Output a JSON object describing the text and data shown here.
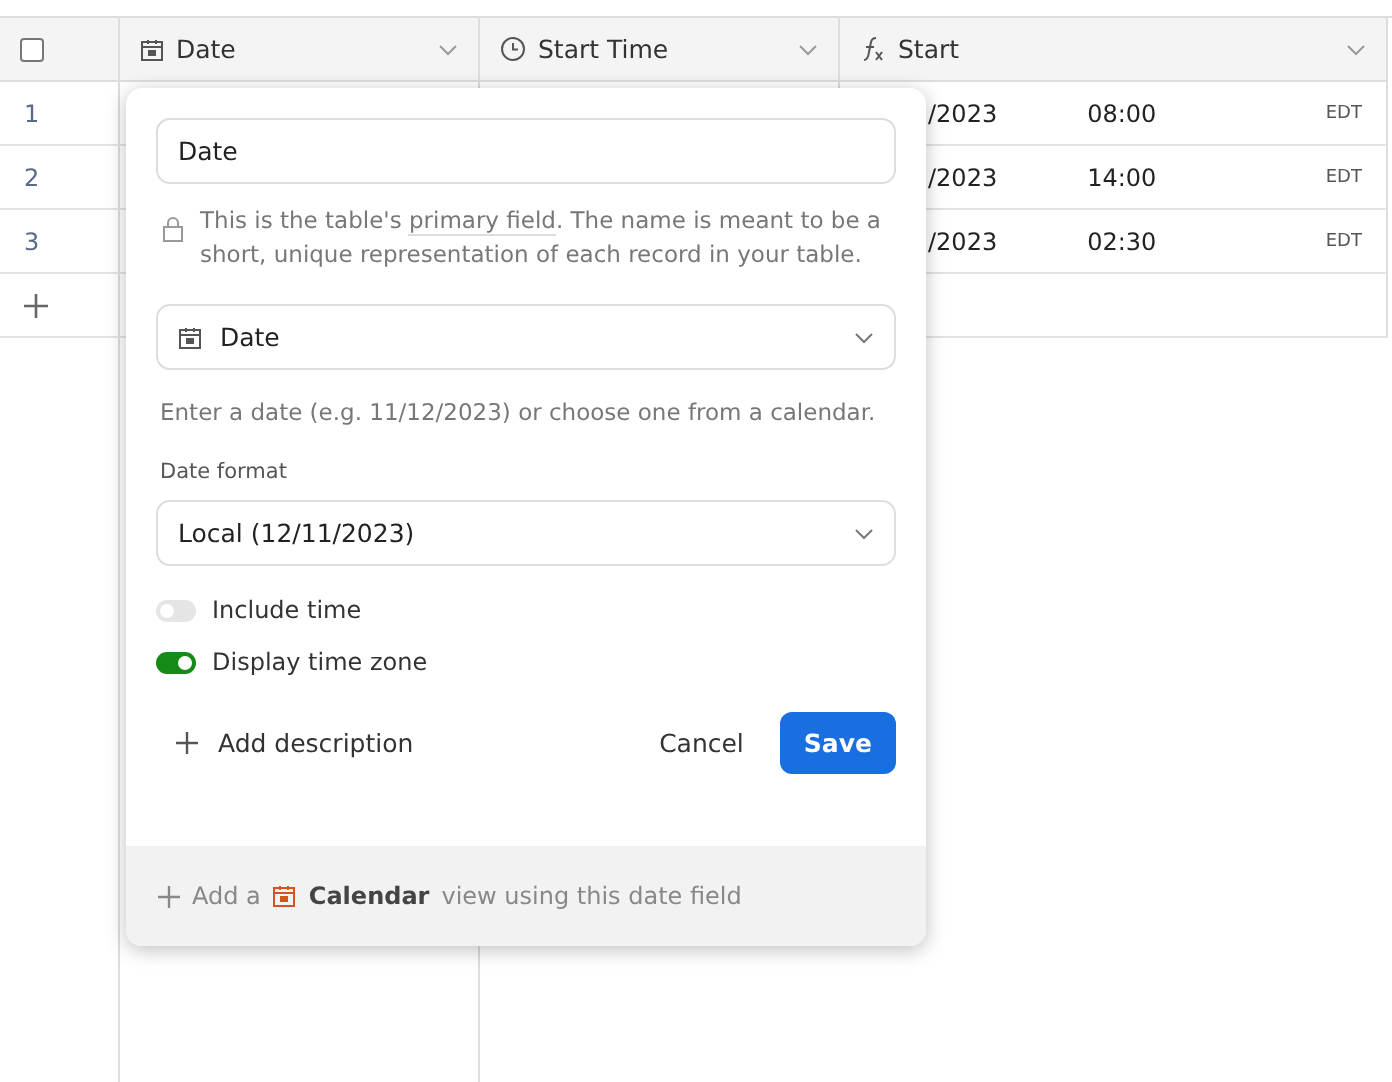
{
  "table": {
    "checkbox": {
      "checked": false
    },
    "columns": [
      {
        "kind": "date",
        "label": "Date"
      },
      {
        "kind": "time",
        "label": "Start Time"
      },
      {
        "kind": "formula",
        "label": "Start"
      }
    ],
    "rows": [
      {
        "number": "1",
        "start_date": "/2023",
        "start_time": "08:00",
        "zone": "EDT"
      },
      {
        "number": "2",
        "start_date": "/2023",
        "start_time": "14:00",
        "zone": "EDT"
      },
      {
        "number": "3",
        "start_date": "/2023",
        "start_time": "02:30",
        "zone": "EDT"
      }
    ]
  },
  "popover": {
    "name_value": "Date",
    "primary_note": {
      "before": "This is the table's ",
      "link": "primary field",
      "after": ". The name is meant to be a short, unique representation of each record in your table."
    },
    "field_type": "Date",
    "type_hint": "Enter a date (e.g. 11/12/2023) or choose one from a calendar.",
    "format_label": "Date format",
    "format_value": "Local (12/11/2023)",
    "toggles": [
      {
        "label": "Include time",
        "on": false
      },
      {
        "label": "Display time zone",
        "on": true
      }
    ],
    "add_description": "Add description",
    "cancel": "Cancel",
    "save": "Save",
    "footer": {
      "before": "Add a",
      "view": "Calendar",
      "after": "view using this date field"
    }
  }
}
